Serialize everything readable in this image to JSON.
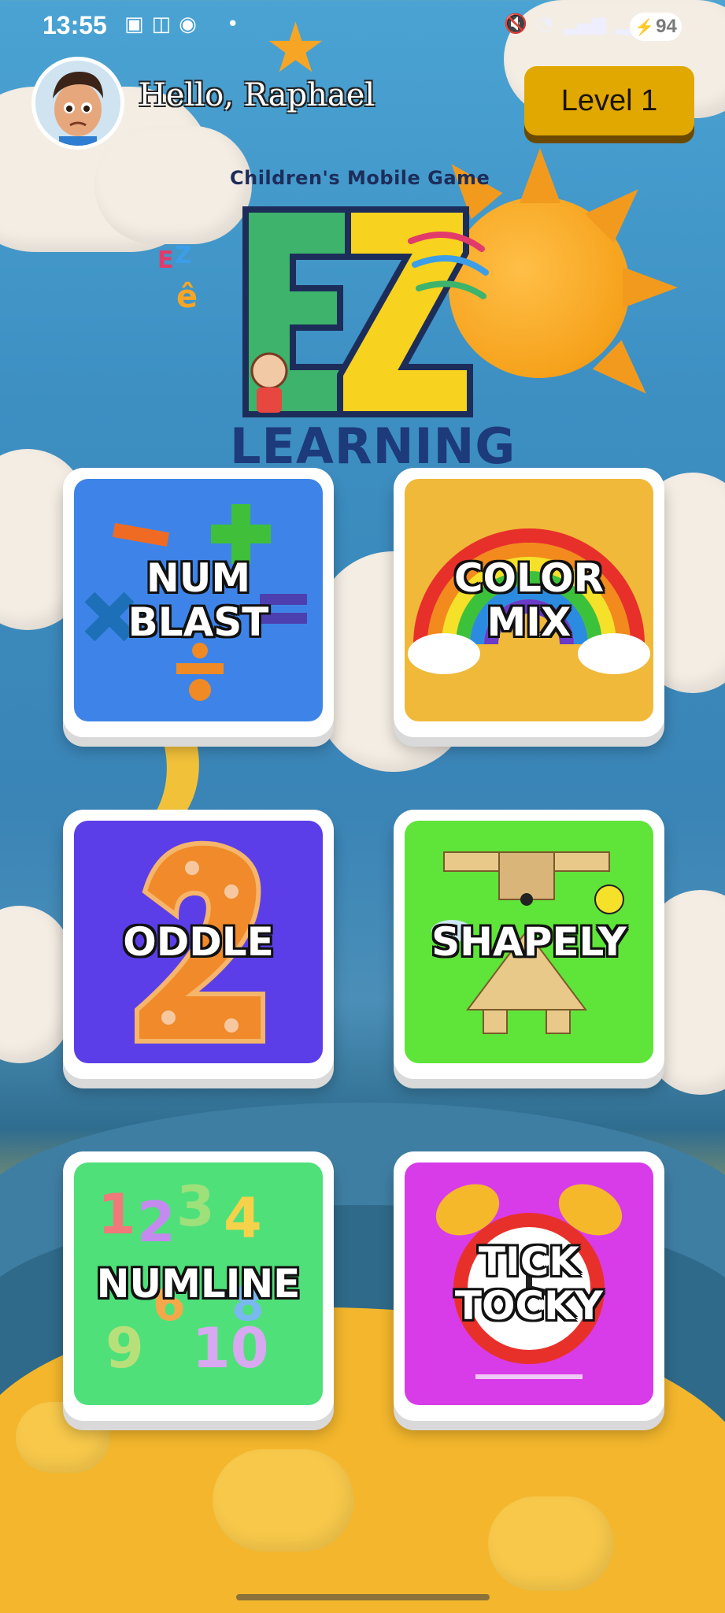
{
  "status_bar": {
    "time": "13:55",
    "battery": "94"
  },
  "header": {
    "greeting": "Hello, Raphael",
    "level_label": "Level 1"
  },
  "logo": {
    "tagline": "Children's Mobile Game",
    "letters": "EZ",
    "word": "LEARNING"
  },
  "games": [
    {
      "label": "NUM\nBLAST",
      "color": "#3e84e8"
    },
    {
      "label": "COLOR\nMIX",
      "color": "#f0b93a"
    },
    {
      "label": "ODDLE",
      "color": "#5b3ee8"
    },
    {
      "label": "SHAPELY",
      "color": "#5fe43a"
    },
    {
      "label": "NUMLINE",
      "color": "#4fe07a"
    },
    {
      "label": "TICK\nTOCKY",
      "color": "#d83ce8"
    }
  ]
}
